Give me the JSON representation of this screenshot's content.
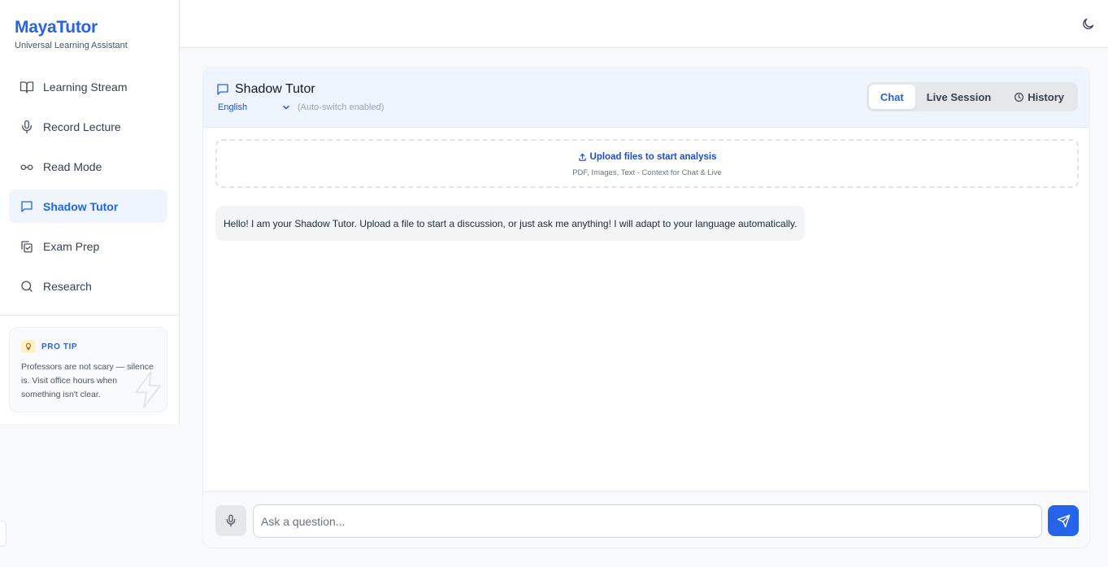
{
  "brand": {
    "title": "MayaTutor",
    "subtitle": "Universal Learning Assistant"
  },
  "sidebar": {
    "items": [
      {
        "label": "Learning Stream",
        "icon": "book-open-icon"
      },
      {
        "label": "Record Lecture",
        "icon": "microphone-icon"
      },
      {
        "label": "Read Mode",
        "icon": "glasses-icon"
      },
      {
        "label": "Shadow Tutor",
        "icon": "chat-bubble-icon",
        "active": true
      },
      {
        "label": "Exam Prep",
        "icon": "clipboard-check-icon"
      },
      {
        "label": "Research",
        "icon": "search-icon"
      }
    ],
    "tip": {
      "label": "PRO TIP",
      "text": "Professors are not scary — silence is. Visit office hours when something isn't clear.",
      "icon": "lightbulb-icon"
    }
  },
  "topbar": {
    "theme_icon": "moon-icon"
  },
  "tutor": {
    "title": "Shadow Tutor",
    "language": "English",
    "language_note": "(Auto-switch enabled)",
    "tabs": [
      {
        "label": "Chat",
        "active": true
      },
      {
        "label": "Live Session"
      },
      {
        "label": "History",
        "icon": "clock-icon"
      }
    ],
    "upload": {
      "title": "Upload files to start analysis",
      "subtitle": "PDF, Images, Text - Context for Chat & Live"
    },
    "messages": [
      {
        "role": "assistant",
        "text": "Hello! I am your Shadow Tutor. Upload a file to start a discussion, or just ask me anything! I will adapt to your language automatically."
      }
    ],
    "input": {
      "placeholder": "Ask a question...",
      "value": ""
    }
  },
  "colors": {
    "accent": "#2563eb",
    "active_bg": "#eff5ff"
  }
}
